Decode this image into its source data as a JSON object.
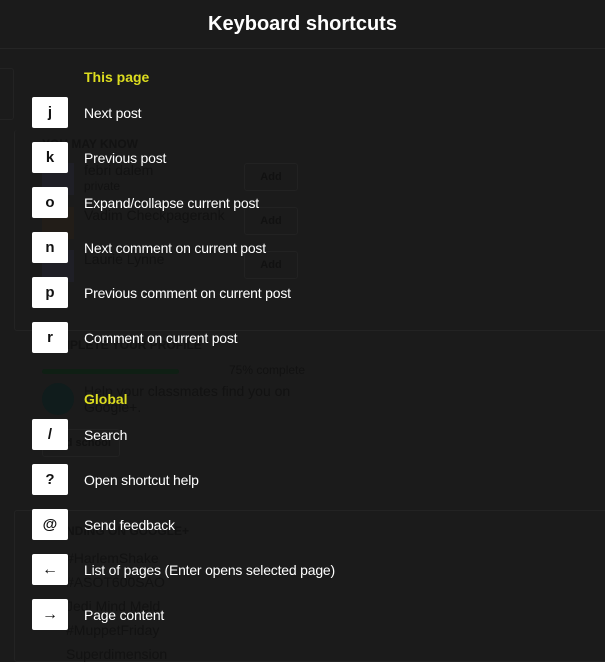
{
  "dialog": {
    "title": "Keyboard shortcuts",
    "sections": [
      {
        "heading": "This page",
        "shortcuts": [
          {
            "key": "j",
            "description": "Next post"
          },
          {
            "key": "k",
            "description": "Previous post"
          },
          {
            "key": "o",
            "description": "Expand/collapse current post"
          },
          {
            "key": "n",
            "description": "Next comment on current post"
          },
          {
            "key": "p",
            "description": "Previous comment on current post"
          },
          {
            "key": "r",
            "description": "Comment on current post"
          }
        ]
      },
      {
        "heading": "Global",
        "shortcuts": [
          {
            "key": "/",
            "description": "Search"
          },
          {
            "key": "?",
            "description": "Open shortcut help"
          },
          {
            "key": "@",
            "description": "Send feedback"
          },
          {
            "key": "←",
            "description": "List of pages (Enter opens selected page)"
          },
          {
            "key": "→",
            "description": "Page content"
          }
        ]
      }
    ]
  },
  "background": {
    "you_may_know": {
      "heading": "YOU MAY KNOW",
      "people": [
        {
          "name": "febri dalem",
          "sub": "private",
          "button": "Add"
        },
        {
          "name": "Vadim Checkpagerank",
          "sub": "",
          "button": "Add"
        },
        {
          "name": "Laurie Lynne",
          "sub": "",
          "button": "Add"
        }
      ]
    },
    "profile": {
      "heading": "COMPLETE YOUR PROFILE",
      "progress_percent": 75,
      "progress_label": "75% complete",
      "prompt": "Help your classmates find you on Google+.",
      "button": "Add school"
    },
    "trending": {
      "heading": "TRENDING ON GOOGLE+",
      "items": [
        "#HarlemShake",
        "#ASOT600SAO",
        "Jedi Mind Meld",
        "#MuppetFriday",
        "Superdimension"
      ]
    }
  }
}
